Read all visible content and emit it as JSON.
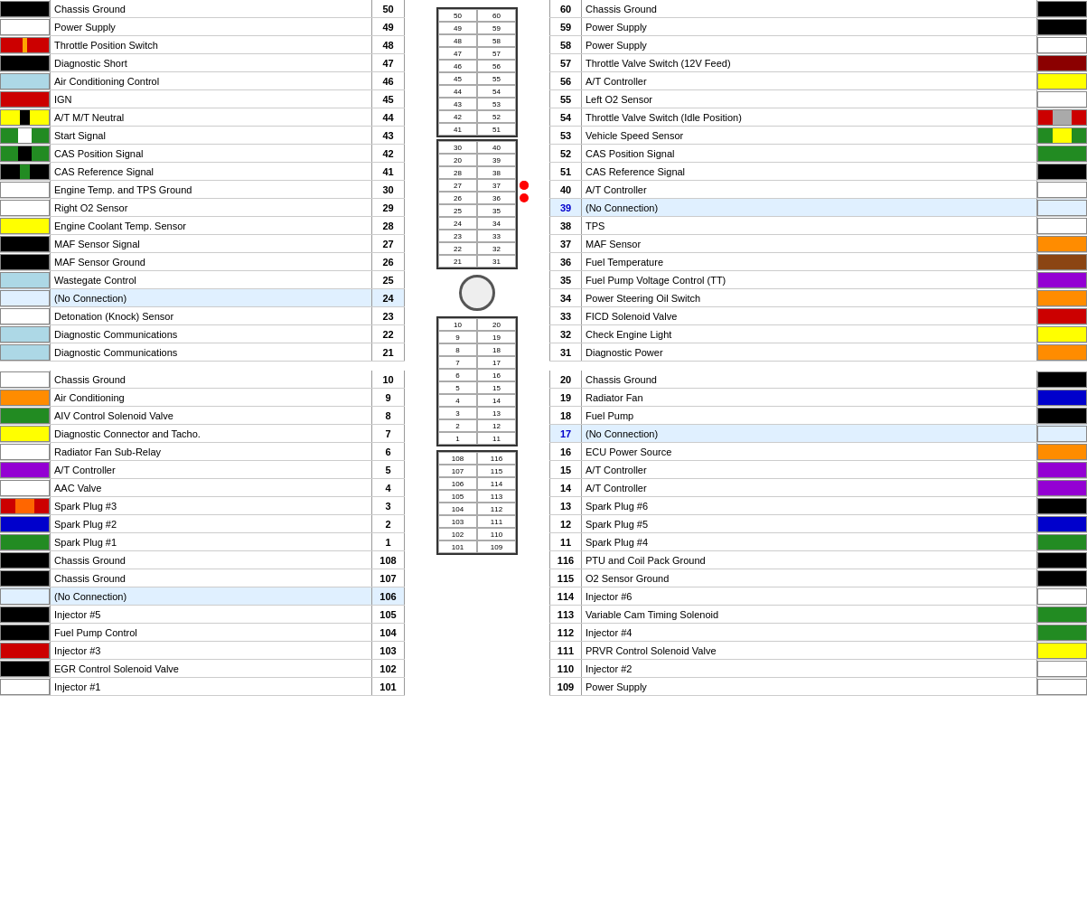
{
  "left_pins": [
    {
      "num": "50",
      "label": "Chassis Ground",
      "color": "#000000"
    },
    {
      "num": "49",
      "label": "Power Supply",
      "color": "#ffffff"
    },
    {
      "num": "48",
      "label": "Throttle Position Switch",
      "color": "#cc0000",
      "stripe": "orange"
    },
    {
      "num": "47",
      "label": "Diagnostic Short",
      "color": "#000000"
    },
    {
      "num": "46",
      "label": "Air Conditioning Control",
      "color": "#add8e6"
    },
    {
      "num": "45",
      "label": "IGN",
      "color": "#cc0000"
    },
    {
      "num": "44",
      "label": "A/T M/T Neutral",
      "color": "#ffff00",
      "stripe2": "#000"
    },
    {
      "num": "43",
      "label": "Start Signal",
      "color": "#228B22",
      "stripe3": "#fff"
    },
    {
      "num": "42",
      "label": "CAS Position Signal",
      "color": "#228B22",
      "stripe3": "#000"
    },
    {
      "num": "41",
      "label": "CAS Reference Signal",
      "color": "#000000",
      "stripe4": "#228B22"
    },
    {
      "num": "30",
      "label": "Engine Temp. and TPS Ground",
      "color": "#ffffff"
    },
    {
      "num": "29",
      "label": "Right O2 Sensor",
      "color": "#ffffff"
    },
    {
      "num": "28",
      "label": "Engine Coolant Temp. Sensor",
      "color": "#ffff00"
    },
    {
      "num": "27",
      "label": "MAF Sensor Signal",
      "color": "#000000"
    },
    {
      "num": "26",
      "label": "MAF Sensor Ground",
      "color": "#000000"
    },
    {
      "num": "25",
      "label": "Wastegate Control",
      "color": "#add8e6"
    },
    {
      "num": "24",
      "label": "(No Connection)",
      "color": "#e0f0ff",
      "noconn": true
    },
    {
      "num": "23",
      "label": "Detonation (Knock) Sensor",
      "color": "#ffffff"
    },
    {
      "num": "22",
      "label": "Diagnostic Communications",
      "color": "#add8e6"
    },
    {
      "num": "21",
      "label": "Diagnostic Communications",
      "color": "#add8e6"
    },
    {
      "spacer": true
    },
    {
      "num": "10",
      "label": "Chassis Ground",
      "color": "#ffffff"
    },
    {
      "num": "9",
      "label": "Air Conditioning",
      "color": "#ff8c00"
    },
    {
      "num": "8",
      "label": "AIV Control Solenoid Valve",
      "color": "#228B22"
    },
    {
      "num": "7",
      "label": "Diagnostic Connector and Tacho.",
      "color": "#ffff00"
    },
    {
      "num": "6",
      "label": "Radiator Fan Sub-Relay",
      "color": "#ffffff"
    },
    {
      "num": "5",
      "label": "A/T Controller",
      "color": "#9400D3"
    },
    {
      "num": "4",
      "label": "AAC Valve",
      "color": "#ffffff"
    },
    {
      "num": "3",
      "label": "Spark Plug #3",
      "color": "#cc0000",
      "stripe5": true
    },
    {
      "num": "2",
      "label": "Spark Plug #2",
      "color": "#0000cc"
    },
    {
      "num": "1",
      "label": "Spark Plug #1",
      "color": "#228B22"
    },
    {
      "num": "108",
      "label": "Chassis Ground",
      "color": "#000000"
    },
    {
      "num": "107",
      "label": "Chassis Ground",
      "color": "#000000"
    },
    {
      "num": "106",
      "label": "(No Connection)",
      "color": "#e0f0ff",
      "noconn": true
    },
    {
      "num": "105",
      "label": "Injector #5",
      "color": "#000000"
    },
    {
      "num": "104",
      "label": "Fuel Pump Control",
      "color": "#000000"
    },
    {
      "num": "103",
      "label": "Injector #3",
      "color": "#cc0000"
    },
    {
      "num": "102",
      "label": "EGR Control Solenoid Valve",
      "color": "#000000"
    },
    {
      "num": "101",
      "label": "Injector #1",
      "color": "#ffffff"
    }
  ],
  "right_pins": [
    {
      "num": "60",
      "label": "Chassis Ground",
      "color": "#000000"
    },
    {
      "num": "59",
      "label": "Power Supply",
      "color": "#000000"
    },
    {
      "num": "58",
      "label": "Power Supply",
      "color": "#ffffff"
    },
    {
      "num": "57",
      "label": "Throttle Valve Switch (12V Feed)",
      "color": "#8B0000"
    },
    {
      "num": "56",
      "label": "A/T Controller",
      "color": "#ffff00"
    },
    {
      "num": "55",
      "label": "Left O2 Sensor",
      "color": "#ffffff"
    },
    {
      "num": "54",
      "label": "Throttle Valve Switch (Idle Position)",
      "color": "#cc0000",
      "right_stripe": "#aaa"
    },
    {
      "num": "53",
      "label": "Vehicle Speed Sensor",
      "color": "#228B22",
      "right_stripe2": "#ffff00"
    },
    {
      "num": "52",
      "label": "CAS Position Signal",
      "color": "#228B22"
    },
    {
      "num": "51",
      "label": "CAS Reference Signal",
      "color": "#000000"
    },
    {
      "num": "40",
      "label": "A/T Controller",
      "color": "#ffffff"
    },
    {
      "num": "39",
      "label": "(No Connection)",
      "color": "#e0f0ff",
      "noconn": true
    },
    {
      "num": "38",
      "label": "TPS",
      "color": "#ffffff"
    },
    {
      "num": "37",
      "label": "MAF Sensor",
      "color": "#ff8c00"
    },
    {
      "num": "36",
      "label": "Fuel Temperature",
      "color": "#8B4513"
    },
    {
      "num": "35",
      "label": "Fuel Pump Voltage Control (TT)",
      "color": "#9400D3"
    },
    {
      "num": "34",
      "label": "Power Steering Oil Switch",
      "color": "#ff8c00"
    },
    {
      "num": "33",
      "label": "FICD Solenoid Valve",
      "color": "#cc0000"
    },
    {
      "num": "32",
      "label": "Check Engine Light",
      "color": "#ffff00"
    },
    {
      "num": "31",
      "label": "Diagnostic Power",
      "color": "#ff8c00"
    },
    {
      "spacer": true
    },
    {
      "num": "20",
      "label": "Chassis Ground",
      "color": "#000000"
    },
    {
      "num": "19",
      "label": "Radiator Fan",
      "color": "#0000cc"
    },
    {
      "num": "18",
      "label": "Fuel Pump",
      "color": "#000000"
    },
    {
      "num": "17",
      "label": "(No Connection)",
      "color": "#e0f0ff",
      "noconn": true
    },
    {
      "num": "16",
      "label": "ECU Power Source",
      "color": "#ff8c00"
    },
    {
      "num": "15",
      "label": "A/T Controller",
      "color": "#9400D3"
    },
    {
      "num": "14",
      "label": "A/T Controller",
      "color": "#9400D3"
    },
    {
      "num": "13",
      "label": "Spark Plug #6",
      "color": "#000000"
    },
    {
      "num": "12",
      "label": "Spark Plug #5",
      "color": "#0000cc"
    },
    {
      "num": "11",
      "label": "Spark Plug #4",
      "color": "#228B22"
    },
    {
      "num": "116",
      "label": "PTU and Coil Pack Ground",
      "color": "#000000"
    },
    {
      "num": "115",
      "label": "O2 Sensor Ground",
      "color": "#000000"
    },
    {
      "num": "114",
      "label": "Injector #6",
      "color": "#ffffff"
    },
    {
      "num": "113",
      "label": "Variable Cam Timing Solenoid",
      "color": "#228B22"
    },
    {
      "num": "112",
      "label": "Injector #4",
      "color": "#228B22"
    },
    {
      "num": "111",
      "label": "PRVR Control Solenoid Valve",
      "color": "#ffff00"
    },
    {
      "num": "110",
      "label": "Injector #2",
      "color": "#ffffff"
    },
    {
      "num": "109",
      "label": "Power Supply",
      "color": "#ffffff"
    }
  ],
  "connector": {
    "top_pairs": [
      [
        "50",
        "60"
      ],
      [
        "49",
        "59"
      ],
      [
        "48",
        "58"
      ],
      [
        "47",
        "57"
      ],
      [
        "46",
        "56"
      ],
      [
        "45",
        "55"
      ],
      [
        "44",
        "54"
      ],
      [
        "43",
        "53"
      ],
      [
        "42",
        "52"
      ],
      [
        "41",
        "51"
      ]
    ],
    "mid_pairs": [
      [
        "30",
        "40"
      ],
      [
        "20",
        "39"
      ],
      [
        "28",
        "38"
      ],
      [
        "27",
        "37"
      ],
      [
        "26",
        "36"
      ],
      [
        "25",
        "35"
      ],
      [
        "24",
        "34"
      ],
      [
        "23",
        "33"
      ],
      [
        "22",
        "32"
      ],
      [
        "21",
        "31"
      ]
    ],
    "bot_pairs": [
      [
        "10",
        "20"
      ],
      [
        "9",
        "19"
      ],
      [
        "8",
        "18"
      ],
      [
        "7",
        "17"
      ],
      [
        "6",
        "16"
      ],
      [
        "5",
        "15"
      ],
      [
        "4",
        "14"
      ],
      [
        "3",
        "13"
      ],
      [
        "2",
        "12"
      ],
      [
        "1",
        "11"
      ]
    ],
    "btm_pairs": [
      [
        "108",
        "116"
      ],
      [
        "107",
        "115"
      ],
      [
        "106",
        "114"
      ],
      [
        "105",
        "113"
      ],
      [
        "104",
        "112"
      ],
      [
        "103",
        "111"
      ],
      [
        "102",
        "110"
      ],
      [
        "101",
        "109"
      ]
    ]
  }
}
